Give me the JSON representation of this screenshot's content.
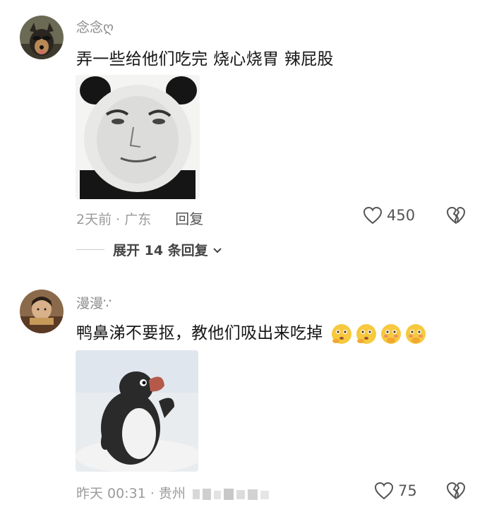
{
  "comments": [
    {
      "username": "念念ღ",
      "text": "弄一些给他们吃完 烧心烧胃 辣屁股",
      "time": "2天前",
      "location": "广东",
      "reply_label": "回复",
      "likes": "450",
      "expand_label": "展开 14 条回复",
      "sticker": "panda-face-meme"
    },
    {
      "username": "漫漫∵",
      "text": "鸭鼻涕不要抠，教他们吸出来吃掉",
      "emojis": [
        "thinking-face",
        "thinking-face",
        "hand-over-mouth-face",
        "hand-over-mouth-face"
      ],
      "time": "昨天 00:31",
      "location": "贵州",
      "likes": "75",
      "sticker": "pingu-penguin"
    }
  ],
  "icons": {
    "like": "heart-outline-icon",
    "dislike": "broken-heart-icon",
    "expand": "chevron-down-icon"
  },
  "colors": {
    "username": "#8a8a8a",
    "meta": "#9a9a9a",
    "text": "#161616"
  }
}
